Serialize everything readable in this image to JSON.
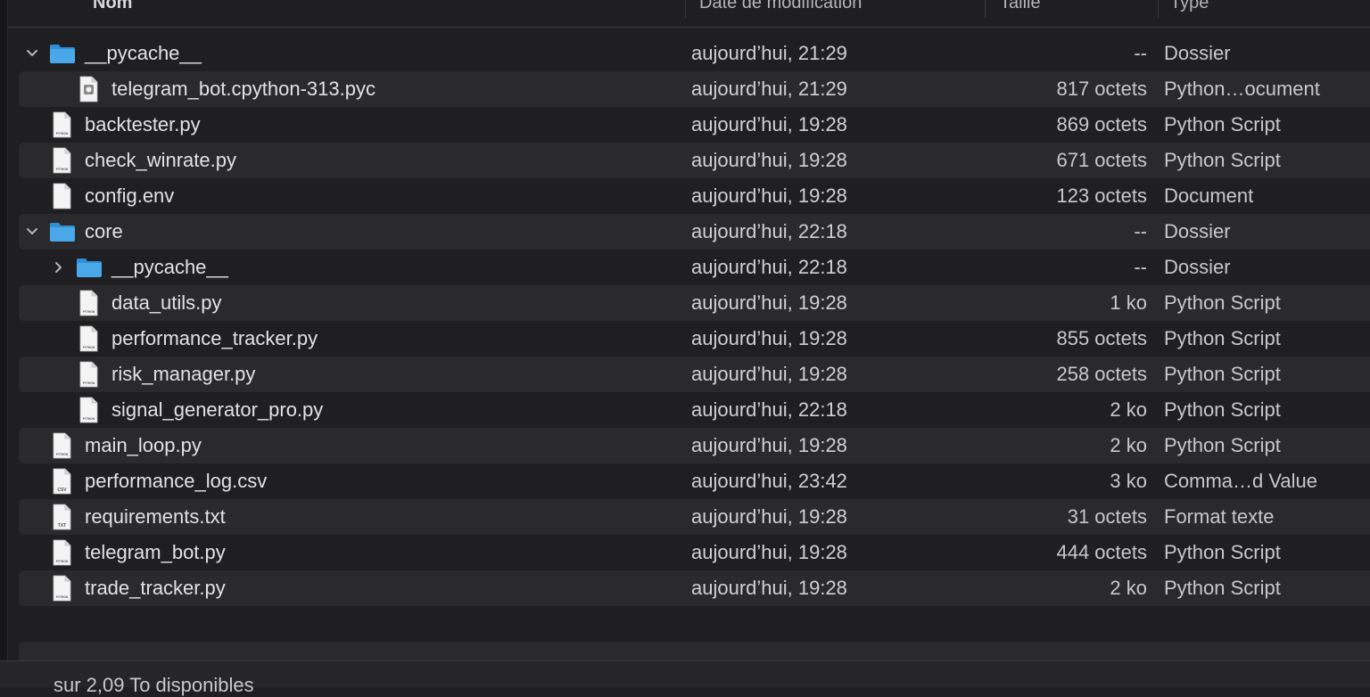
{
  "columns": {
    "name": "Nom",
    "date": "Date de modification",
    "size": "Taille",
    "type": "Type"
  },
  "rows": [
    {
      "name": "__pycache__",
      "date": "aujourd’hui, 21:29",
      "size": "--",
      "type": "Dossier",
      "kind": "folder",
      "expanded": true,
      "level": 0
    },
    {
      "name": "telegram_bot.cpython-313.pyc",
      "date": "aujourd’hui, 21:29",
      "size": "817 octets",
      "type": "Python…ocument",
      "kind": "pyc",
      "level": 1
    },
    {
      "name": "backtester.py",
      "date": "aujourd’hui, 19:28",
      "size": "869 octets",
      "type": "Python Script",
      "kind": "py",
      "level": 0
    },
    {
      "name": "check_winrate.py",
      "date": "aujourd’hui, 19:28",
      "size": "671 octets",
      "type": "Python Script",
      "kind": "py",
      "level": 0
    },
    {
      "name": "config.env",
      "date": "aujourd’hui, 19:28",
      "size": "123 octets",
      "type": "Document",
      "kind": "blank",
      "level": 0
    },
    {
      "name": "core",
      "date": "aujourd’hui, 22:18",
      "size": "--",
      "type": "Dossier",
      "kind": "folder",
      "expanded": true,
      "level": 0
    },
    {
      "name": "__pycache__",
      "date": "aujourd’hui, 22:18",
      "size": "--",
      "type": "Dossier",
      "kind": "folder",
      "expanded": false,
      "level": 1
    },
    {
      "name": "data_utils.py",
      "date": "aujourd’hui, 19:28",
      "size": "1 ko",
      "type": "Python Script",
      "kind": "py",
      "level": 1
    },
    {
      "name": "performance_tracker.py",
      "date": "aujourd’hui, 19:28",
      "size": "855 octets",
      "type": "Python Script",
      "kind": "py",
      "level": 1
    },
    {
      "name": "risk_manager.py",
      "date": "aujourd’hui, 19:28",
      "size": "258 octets",
      "type": "Python Script",
      "kind": "py",
      "level": 1
    },
    {
      "name": "signal_generator_pro.py",
      "date": "aujourd’hui, 22:18",
      "size": "2 ko",
      "type": "Python Script",
      "kind": "py",
      "level": 1
    },
    {
      "name": "main_loop.py",
      "date": "aujourd’hui, 19:28",
      "size": "2 ko",
      "type": "Python Script",
      "kind": "py",
      "level": 0
    },
    {
      "name": "performance_log.csv",
      "date": "aujourd’hui, 23:42",
      "size": "3 ko",
      "type": "Comma…d Value",
      "kind": "csv",
      "level": 0
    },
    {
      "name": "requirements.txt",
      "date": "aujourd’hui, 19:28",
      "size": "31 octets",
      "type": "Format texte",
      "kind": "txt",
      "level": 0
    },
    {
      "name": "telegram_bot.py",
      "date": "aujourd’hui, 19:28",
      "size": "444 octets",
      "type": "Python Script",
      "kind": "py",
      "level": 0
    },
    {
      "name": "trade_tracker.py",
      "date": "aujourd’hui, 19:28",
      "size": "2 ko",
      "type": "Python Script",
      "kind": "py",
      "level": 0
    }
  ],
  "icons": {
    "folder": "folder-icon",
    "py": "python-file-icon",
    "pyc": "python-compiled-file-icon",
    "blank": "document-icon",
    "csv": "csv-file-icon",
    "txt": "text-file-icon",
    "sort": "sort-chevron-icon",
    "disclosure_open": "chevron-down-icon",
    "disclosure_closed": "chevron-right-icon"
  },
  "file_labels": {
    "py": "PYTHON",
    "csv": "CSV",
    "txt": "TXT"
  },
  "colors": {
    "folder": "#4aa7e8",
    "folder_tab": "#2f8fd6",
    "row_alt": "#2a2a2c",
    "background": "#1f1f21"
  },
  "status": {
    "text": "sur 2,09 To disponibles"
  }
}
